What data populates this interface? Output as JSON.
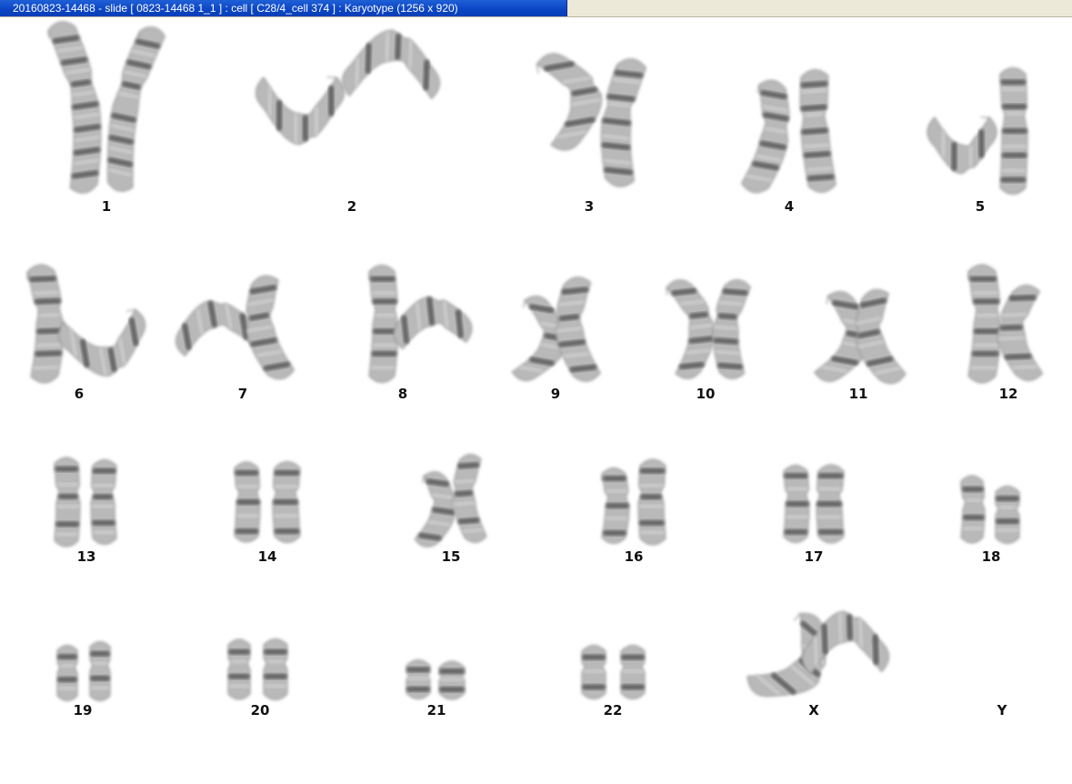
{
  "window": {
    "title": "20160823-14468 - slide [ 0823-14468 1_1 ] : cell [ C28/4_cell 374 ] : Karyotype  (1256 x 920)"
  },
  "karyotype": {
    "chromosomes": [
      {
        "label": "1"
      },
      {
        "label": "2"
      },
      {
        "label": "3"
      },
      {
        "label": "4"
      },
      {
        "label": "5"
      },
      {
        "label": "6"
      },
      {
        "label": "7"
      },
      {
        "label": "8"
      },
      {
        "label": "9"
      },
      {
        "label": "10"
      },
      {
        "label": "11"
      },
      {
        "label": "12"
      },
      {
        "label": "13"
      },
      {
        "label": "14"
      },
      {
        "label": "15"
      },
      {
        "label": "16"
      },
      {
        "label": "17"
      },
      {
        "label": "18"
      },
      {
        "label": "19"
      },
      {
        "label": "20"
      },
      {
        "label": "21"
      },
      {
        "label": "22"
      },
      {
        "label": "X"
      },
      {
        "label": "Y"
      }
    ]
  }
}
